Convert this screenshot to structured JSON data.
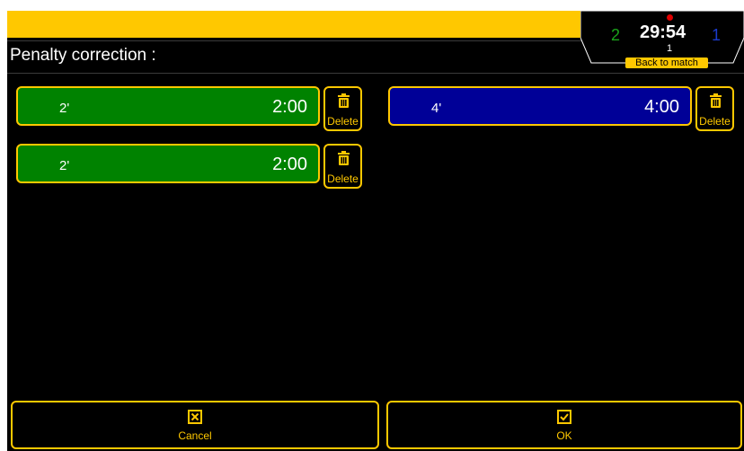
{
  "header": {
    "title": "Penalty correction :"
  },
  "scoreboard": {
    "home_score": "2",
    "away_score": "1",
    "clock": "29:54",
    "period": "1",
    "back_label": "Back to match",
    "home_color": "#1aa31a",
    "away_color": "#1a3acc"
  },
  "home_penalties": [
    {
      "label": "2'",
      "time": "2:00",
      "delete_label": "Delete"
    },
    {
      "label": "2'",
      "time": "2:00",
      "delete_label": "Delete"
    }
  ],
  "away_penalties": [
    {
      "label": "4'",
      "time": "4:00",
      "delete_label": "Delete"
    }
  ],
  "footer": {
    "cancel_label": "Cancel",
    "ok_label": "OK"
  },
  "colors": {
    "accent": "#ffc800",
    "home_team": "#008200",
    "away_team": "#000097",
    "background": "#000000"
  },
  "icons": {
    "delete": "trash-icon",
    "cancel": "checkbox-x-icon",
    "ok": "checkbox-check-icon"
  }
}
